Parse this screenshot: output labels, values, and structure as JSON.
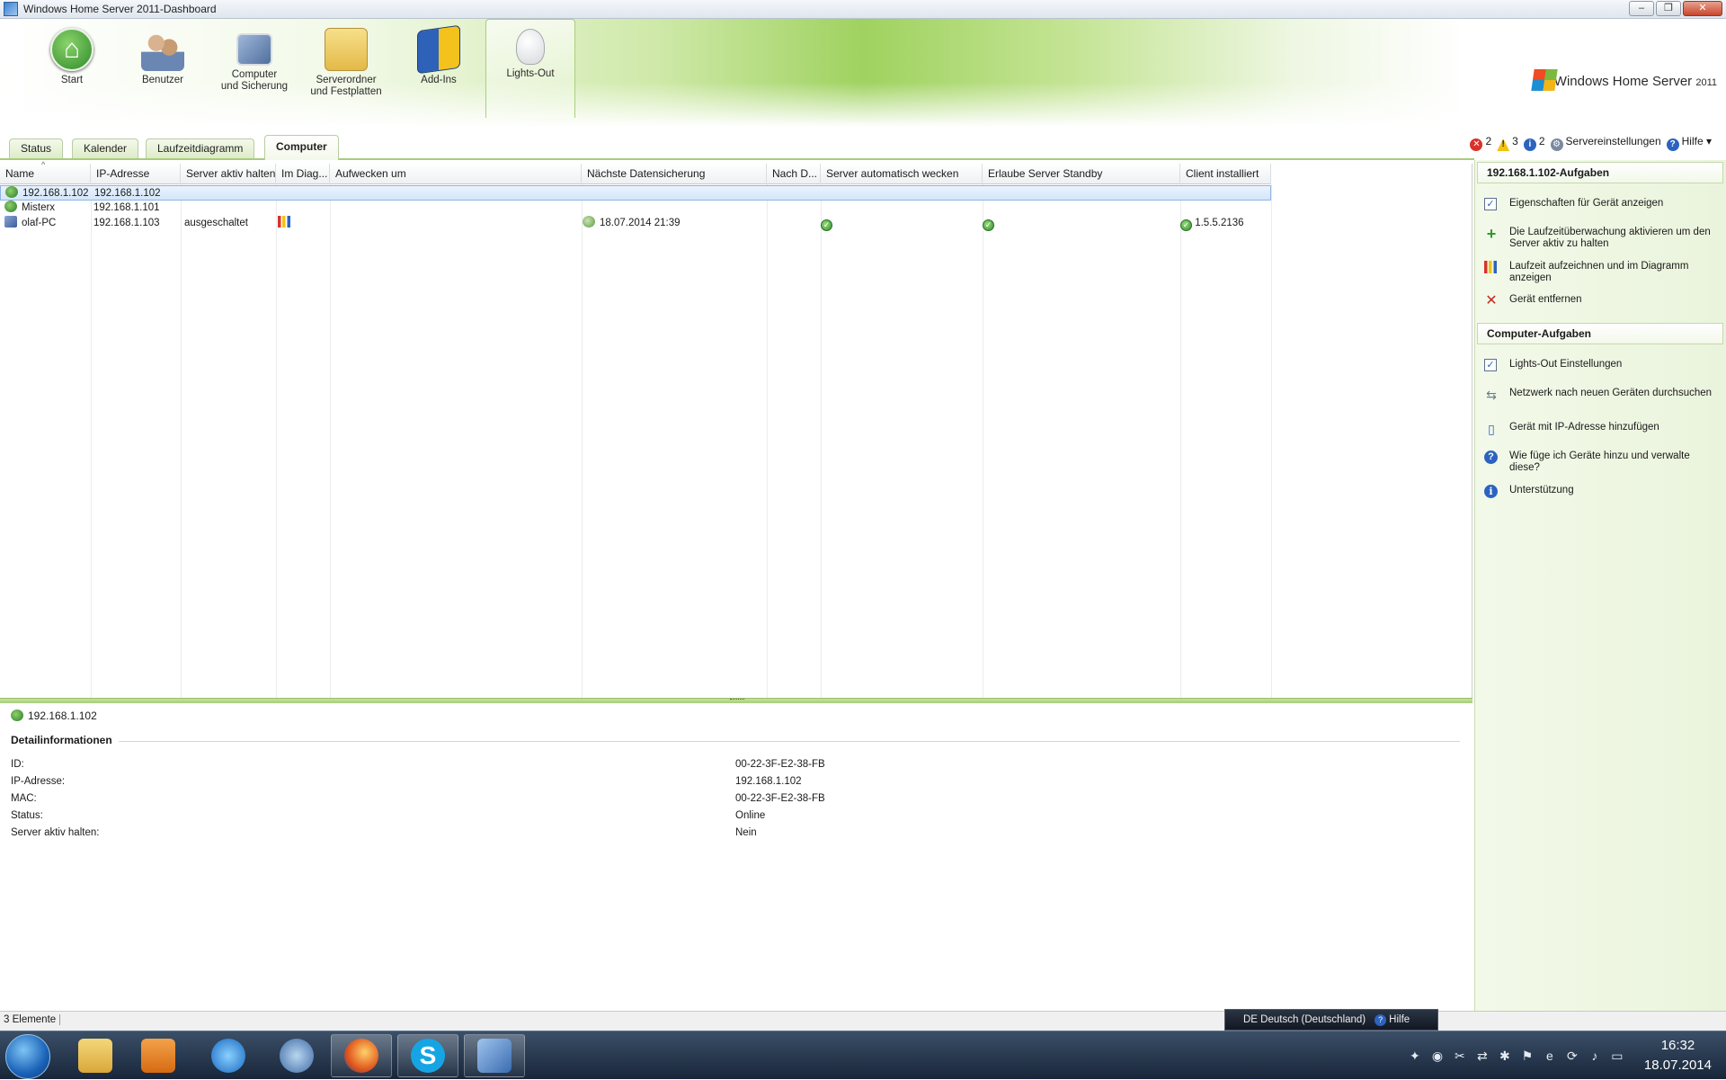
{
  "window": {
    "title": "Windows Home Server 2011-Dashboard",
    "controls": [
      "minimize",
      "restore",
      "close"
    ]
  },
  "nav": [
    {
      "label": "Start",
      "icon": "home-icon"
    },
    {
      "label": "Benutzer",
      "icon": "users-icon"
    },
    {
      "label": "Computer\nund Sicherung",
      "icon": "computer-icon"
    },
    {
      "label": "Serverordner\nund Festplatten",
      "icon": "folder-icon"
    },
    {
      "label": "Add-Ins",
      "icon": "addin-icon"
    },
    {
      "label": "Lights-Out",
      "icon": "bulb-icon",
      "active": true
    }
  ],
  "logo": {
    "text": "Windows Home Server",
    "year": "2011"
  },
  "tabs": [
    "Status",
    "Kalender",
    "Laufzeitdiagramm",
    "Computer"
  ],
  "active_tab": "Computer",
  "alerts": {
    "errors": "2",
    "warnings": "3",
    "infos": "2",
    "settings": "Servereinstellungen",
    "help": "Hilfe"
  },
  "table": {
    "columns": [
      "Name",
      "IP-Adresse",
      "Server aktiv halten",
      "Im Diag...",
      "Aufwecken um",
      "Nächste Datensicherung",
      "Nach D...",
      "Server automatisch wecken",
      "Erlaube Server Standby",
      "Client installiert"
    ],
    "rows": [
      {
        "name": "192.168.1.102",
        "ip": "192.168.1.102",
        "keep_alive": "",
        "backup": "",
        "client": "",
        "selected": true,
        "type": "server"
      },
      {
        "name": "Misterx",
        "ip": "192.168.1.101",
        "keep_alive": "",
        "backup": "",
        "client": "",
        "selected": false,
        "type": "server"
      },
      {
        "name": "olaf-PC",
        "ip": "192.168.1.103",
        "keep_alive": "ausgeschaltet",
        "backup": "18.07.2014 21:39",
        "client": "1.5.5.2136",
        "selected": false,
        "type": "pc"
      }
    ]
  },
  "detail": {
    "header": "192.168.1.102",
    "section": "Detailinformationen",
    "fields": [
      {
        "key": "ID:",
        "value": "00-22-3F-E2-38-FB"
      },
      {
        "key": "IP-Adresse:",
        "value": "192.168.1.102"
      },
      {
        "key": "MAC:",
        "value": "00-22-3F-E2-38-FB"
      },
      {
        "key": "Status:",
        "value": "Online"
      },
      {
        "key": "Server aktiv halten:",
        "value": "Nein"
      }
    ]
  },
  "sidebar": {
    "device_tasks_title": "192.168.1.102-Aufgaben",
    "device_tasks": [
      "Eigenschaften für Gerät anzeigen",
      "Die Laufzeitüberwachung aktivieren um den Server aktiv zu halten",
      "Laufzeit aufzeichnen und im Diagramm anzeigen",
      "Gerät entfernen"
    ],
    "computer_tasks_title": "Computer-Aufgaben",
    "computer_tasks": [
      "Lights-Out Einstellungen",
      "Netzwerk nach neuen Geräten durchsuchen",
      "Gerät mit IP-Adresse hinzufügen",
      "Wie füge ich Geräte hinzu und verwalte diese?",
      "Unterstützung"
    ]
  },
  "status": {
    "count": "3 Elemente"
  },
  "language_bar": {
    "lang": "DE Deutsch (Deutschland)",
    "help": "Hilfe"
  },
  "clock": {
    "time": "16:32",
    "date": "18.07.2014"
  },
  "colors": {
    "accent": "#9fd25f",
    "selection": "#d4e6fb",
    "taskbar": "#18263a"
  }
}
